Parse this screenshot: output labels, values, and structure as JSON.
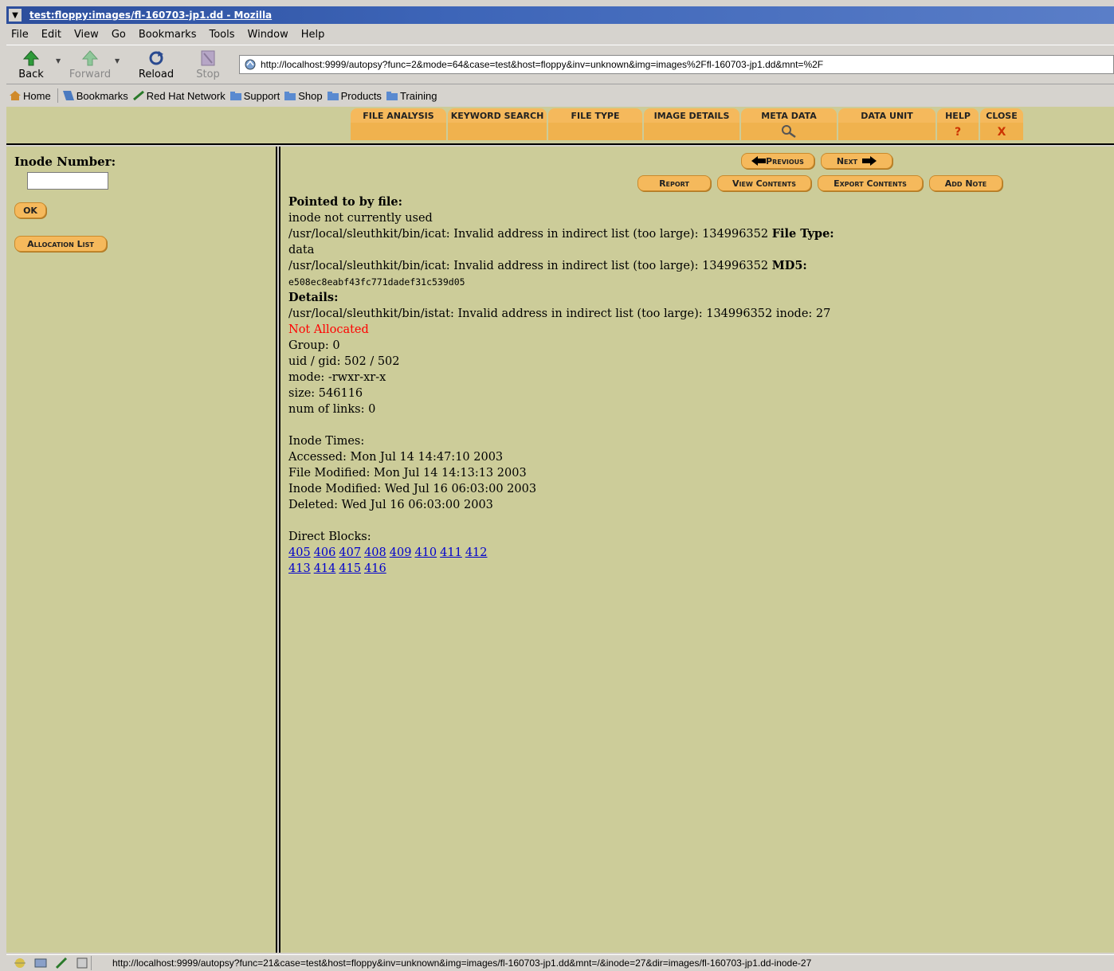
{
  "window": {
    "title": "test:floppy:images/fl-160703-jp1.dd - Mozilla"
  },
  "menu": [
    "File",
    "Edit",
    "View",
    "Go",
    "Bookmarks",
    "Tools",
    "Window",
    "Help"
  ],
  "nav": {
    "back": "Back",
    "forward": "Forward",
    "reload": "Reload",
    "stop": "Stop",
    "url": "http://localhost:9999/autopsy?func=2&mode=64&case=test&host=floppy&inv=unknown&img=images%2Ffl-160703-jp1.dd&mnt=%2F"
  },
  "personal_toolbar": [
    "Home",
    "Bookmarks",
    "Red Hat Network",
    "Support",
    "Shop",
    "Products",
    "Training"
  ],
  "tabs": [
    "File Analysis",
    "Keyword Search",
    "File Type",
    "Image Details",
    "Meta Data",
    "Data Unit",
    "Help",
    "Close"
  ],
  "tab_extras": {
    "help": "?",
    "close": "X"
  },
  "left": {
    "inode_label": "Inode Number:",
    "ok": "OK",
    "allocation_list": "Allocation List"
  },
  "main": {
    "previous": "Previous",
    "next": "Next",
    "report": "Report",
    "view_contents": "View Contents",
    "export_contents": "Export Contents",
    "add_note": "Add Note",
    "pointed_label": "Pointed to by file:",
    "pointed_value": "inode not currently used",
    "icat_err_1": "/usr/local/sleuthkit/bin/icat: Invalid address in indirect list (too large): 134996352",
    "file_type_label": "File Type:",
    "file_type_value": "data",
    "icat_err_2": "/usr/local/sleuthkit/bin/icat: Invalid address in indirect list (too large): 134996352",
    "md5_label": "MD5:",
    "md5_value": "e508ec8eabf43fc771dadef31c539d05",
    "details_label": "Details:",
    "istat_err": "/usr/local/sleuthkit/bin/istat: Invalid address in indirect list (too large): 134996352 inode: 27",
    "not_allocated": "Not Allocated",
    "group": "Group: 0",
    "uid_gid": "uid / gid: 502 / 502",
    "mode": "mode: -rwxr-xr-x",
    "size": "size: 546116",
    "links": "num of links: 0",
    "times_label": "Inode Times:",
    "accessed": "Accessed: Mon Jul 14 14:47:10 2003",
    "file_modified": "File Modified: Mon Jul 14 14:13:13 2003",
    "inode_modified": "Inode Modified: Wed Jul 16 06:03:00 2003",
    "deleted": "Deleted: Wed Jul 16 06:03:00 2003",
    "blocks_label": "Direct Blocks:",
    "blocks_row1": [
      "405",
      "406",
      "407",
      "408",
      "409",
      "410",
      "411",
      "412"
    ],
    "blocks_row2": [
      "413",
      "414",
      "415",
      "416"
    ]
  },
  "status": {
    "url": "http://localhost:9999/autopsy?func=21&case=test&host=floppy&inv=unknown&img=images/fl-160703-jp1.dd&mnt=/&inode=27&dir=images/fl-160703-jp1.dd-inode-27"
  },
  "colors": {
    "frame_bg": "#cccc99",
    "button_orange": "#f5b95c",
    "alert_red": "#ff0000",
    "link_blue": "#0000cc"
  }
}
